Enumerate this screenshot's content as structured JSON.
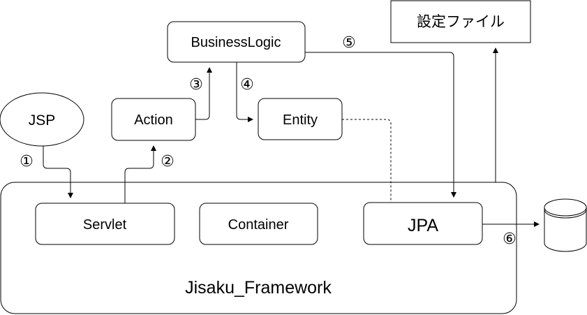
{
  "diagram": {
    "nodes": {
      "jsp": "JSP",
      "action": "Action",
      "business_logic": "BusinessLogic",
      "entity": "Entity",
      "config_file": "設定ファイル",
      "servlet": "Servlet",
      "container": "Container",
      "jpa": "JPA",
      "framework": "Jisaku_Framework",
      "database": ""
    },
    "steps": {
      "s1": "①",
      "s2": "②",
      "s3": "③",
      "s4": "④",
      "s5": "⑤",
      "s6": "⑥"
    },
    "colors": {
      "stroke": "#000000",
      "fill": "#ffffff",
      "text": "#000000"
    }
  }
}
